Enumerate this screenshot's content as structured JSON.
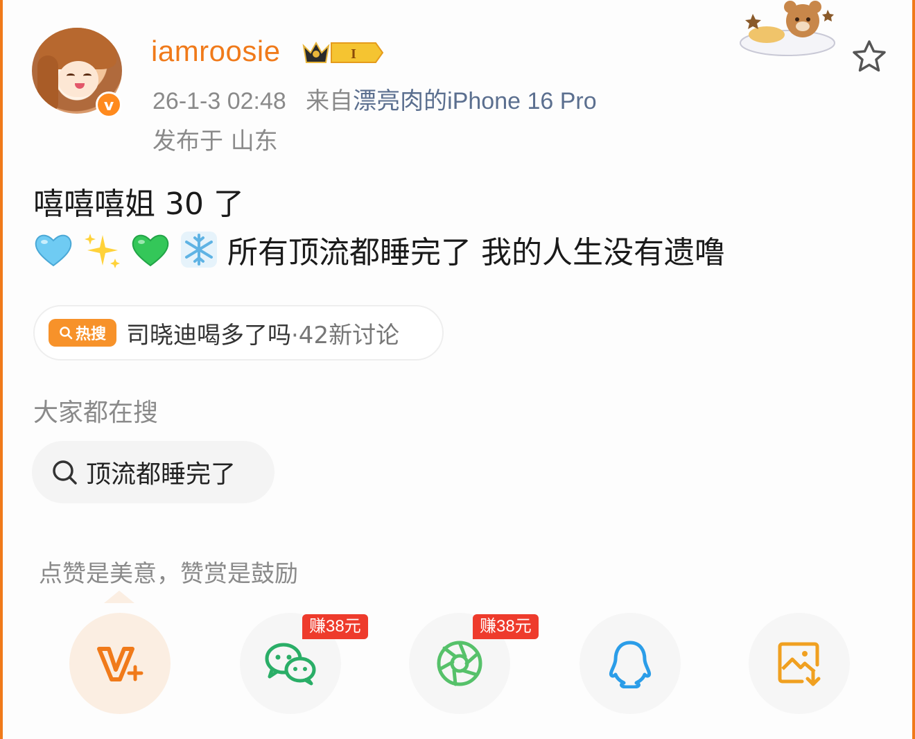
{
  "user": {
    "name": "iamroosie",
    "level_badge": "I",
    "verified_mark": "v",
    "avatar_icon": "anime-girl-avatar",
    "time": "26-1-3 02:48",
    "source_prefix": "来自",
    "source_device": "漂亮肉的iPhone 16 Pro",
    "location": "发布于 山东"
  },
  "post": {
    "line1": "嘻嘻嘻姐 30 了",
    "emojis": [
      "light-blue-heart",
      "sparkles",
      "green-heart",
      "snowflake"
    ],
    "line2": "所有顶流都睡完了 我的人生没有遗噜"
  },
  "hot_topic": {
    "tag": "热搜",
    "title": "司晓迪喝多了吗",
    "count": "·42新讨论"
  },
  "search": {
    "heading": "大家都在搜",
    "query": "顶流都睡完了"
  },
  "reward": {
    "tip": "点赞是美意，赞赏是鼓励"
  },
  "share": {
    "items": [
      {
        "icon": "v-plus-icon",
        "badge": ""
      },
      {
        "icon": "wechat-icon",
        "badge": "赚38元"
      },
      {
        "icon": "moments-icon",
        "badge": "赚38元"
      },
      {
        "icon": "qq-icon",
        "badge": ""
      },
      {
        "icon": "save-image-icon",
        "badge": ""
      }
    ]
  },
  "colors": {
    "accent": "#f07a1a",
    "hot_tag": "#f7922a",
    "earn_badge": "#ee3b2c",
    "wechat": "#2aae67",
    "qq": "#2b9de8",
    "save": "#f0a020"
  }
}
